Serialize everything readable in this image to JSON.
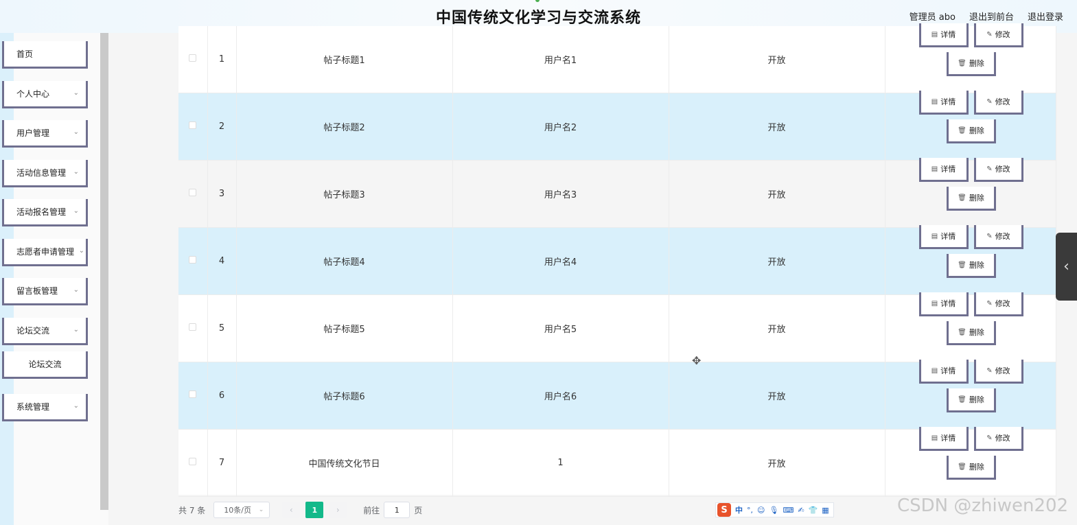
{
  "header": {
    "title": "中国传统文化学习与交流系统",
    "user": "管理员 abo",
    "front_link": "退出到前台",
    "logout": "退出登录"
  },
  "sidebar": {
    "items": [
      {
        "label": "首页"
      },
      {
        "label": "个人中心"
      },
      {
        "label": "用户管理"
      },
      {
        "label": "活动信息管理"
      },
      {
        "label": "活动报名管理"
      },
      {
        "label": "志愿者申请管理"
      },
      {
        "label": "留言板管理"
      },
      {
        "label": "论坛交流"
      },
      {
        "label": "论坛交流"
      },
      {
        "label": "系统管理"
      }
    ]
  },
  "table": {
    "rows": [
      {
        "index": "1",
        "title": "帖子标题1",
        "user": "用户名1",
        "status": "开放"
      },
      {
        "index": "2",
        "title": "帖子标题2",
        "user": "用户名2",
        "status": "开放"
      },
      {
        "index": "3",
        "title": "帖子标题3",
        "user": "用户名3",
        "status": "开放"
      },
      {
        "index": "4",
        "title": "帖子标题4",
        "user": "用户名4",
        "status": "开放"
      },
      {
        "index": "5",
        "title": "帖子标题5",
        "user": "用户名5",
        "status": "开放"
      },
      {
        "index": "6",
        "title": "帖子标题6",
        "user": "用户名6",
        "status": "开放"
      },
      {
        "index": "7",
        "title": "中国传统文化节日",
        "user": "1",
        "status": "开放"
      }
    ],
    "actions": {
      "detail": "详情",
      "edit": "修改",
      "delete": "删除"
    }
  },
  "pagination": {
    "total": "共 7 条",
    "page_size": "10条/页",
    "current_page": "1",
    "goto_label": "前往",
    "goto_value": "1",
    "page_suffix": "页"
  },
  "ime": {
    "logo": "S",
    "mode": "中"
  },
  "watermark": "CSDN @zhiwen202"
}
